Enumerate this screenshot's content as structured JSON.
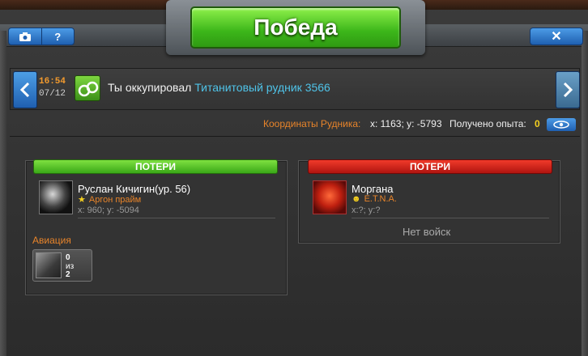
{
  "header": {
    "title": "Победа",
    "camera_icon": "camera-icon",
    "help_label": "?",
    "close_label": "✕"
  },
  "event": {
    "time": "16:54",
    "date": "07/12",
    "message": "Ты оккупировал",
    "target": "Титанитовый рудник 3566",
    "icon": "handcuffs-icon"
  },
  "info": {
    "coords_label": "Координаты Рудника:",
    "coords_value": "x: 1163; y: -5793",
    "xp_label": "Получено опыта:",
    "xp_value": "0"
  },
  "left_panel": {
    "losses_label": "ПОТЕРИ",
    "player_name": "Руслан Кичигин(ур. 56)",
    "alliance": "Аргон прайм",
    "coords": "x: 960; y: -5094",
    "section": "Авиация",
    "unit_lost": "0",
    "unit_of": "из",
    "unit_total": "2"
  },
  "right_panel": {
    "losses_label": "ПОТЕРИ",
    "player_name": "Моргана",
    "alliance": "E.T.N.A.",
    "coords": "x:?; y:?",
    "no_troops": "Нет войск"
  },
  "colors": {
    "accent_green": "#3cb61a",
    "loss_red": "#d01a14",
    "orange": "#e8842a",
    "link_blue": "#4fc3e8"
  }
}
